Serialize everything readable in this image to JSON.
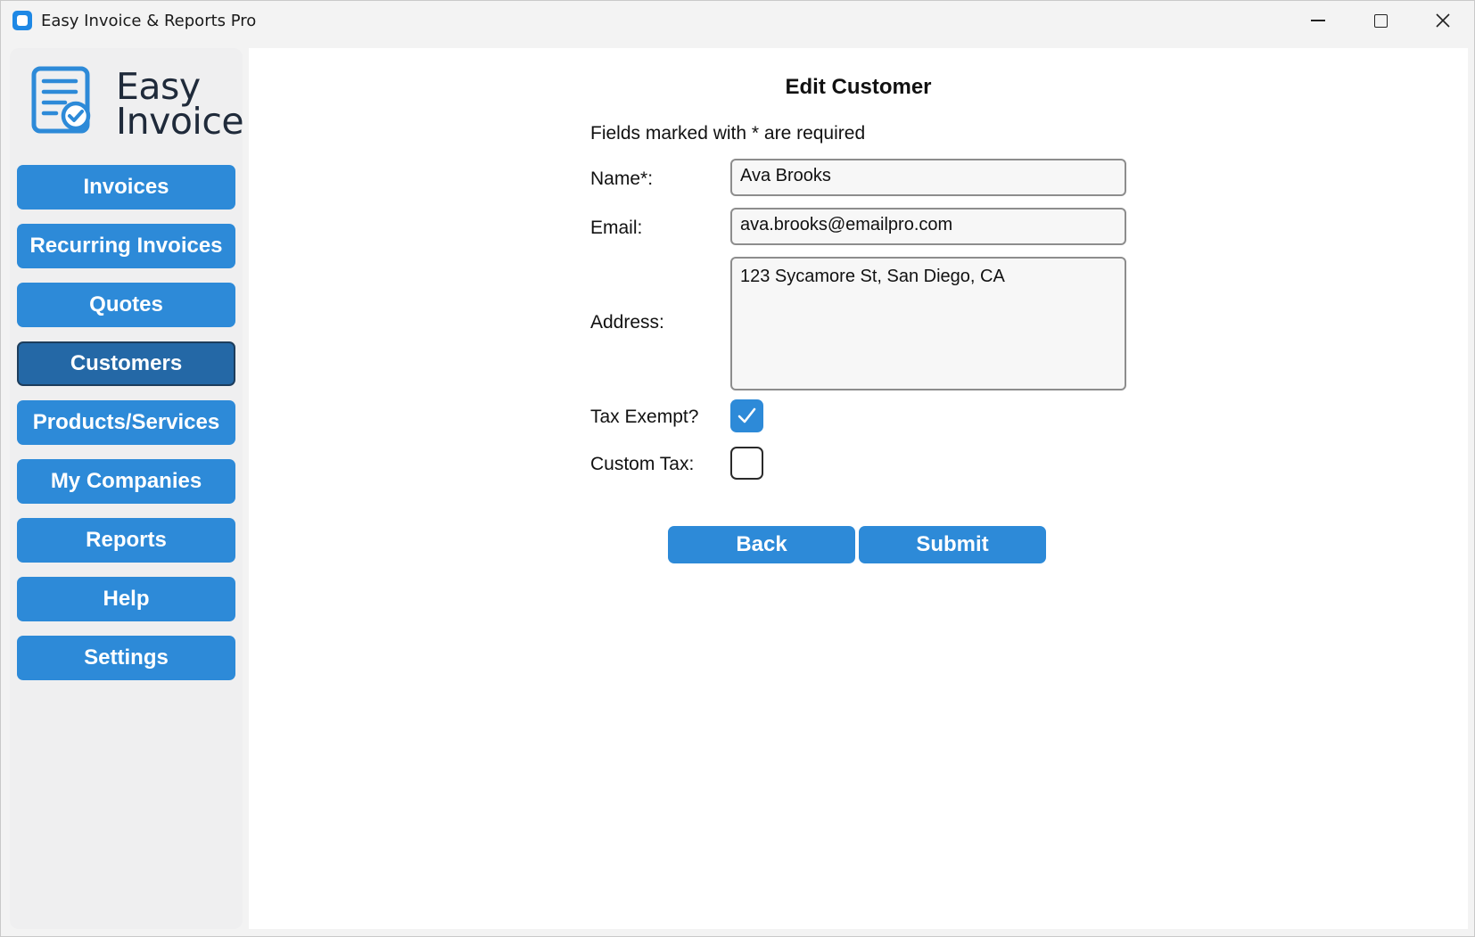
{
  "window": {
    "title": "Easy Invoice & Reports Pro"
  },
  "sidebar": {
    "logo_line1": "Easy",
    "logo_line2": "Invoice",
    "items": [
      {
        "label": "Invoices"
      },
      {
        "label": "Recurring Invoices"
      },
      {
        "label": "Quotes"
      },
      {
        "label": "Customers",
        "active": true
      },
      {
        "label": "Products/Services"
      },
      {
        "label": "My Companies"
      },
      {
        "label": "Reports"
      },
      {
        "label": "Help"
      },
      {
        "label": "Settings"
      }
    ]
  },
  "form": {
    "title": "Edit Customer",
    "required_note": "Fields marked with * are required",
    "name_label": "Name*:",
    "name_value": "Ava Brooks",
    "email_label": "Email:",
    "email_value": "ava.brooks@emailpro.com",
    "address_label": "Address:",
    "address_value": "123 Sycamore St, San Diego, CA",
    "tax_exempt_label": "Tax Exempt?",
    "tax_exempt_checked": true,
    "custom_tax_label": "Custom Tax:",
    "custom_tax_checked": false,
    "back_label": "Back",
    "submit_label": "Submit"
  },
  "colors": {
    "accent": "#2d8ad8",
    "active_nav": "#2468a6"
  }
}
